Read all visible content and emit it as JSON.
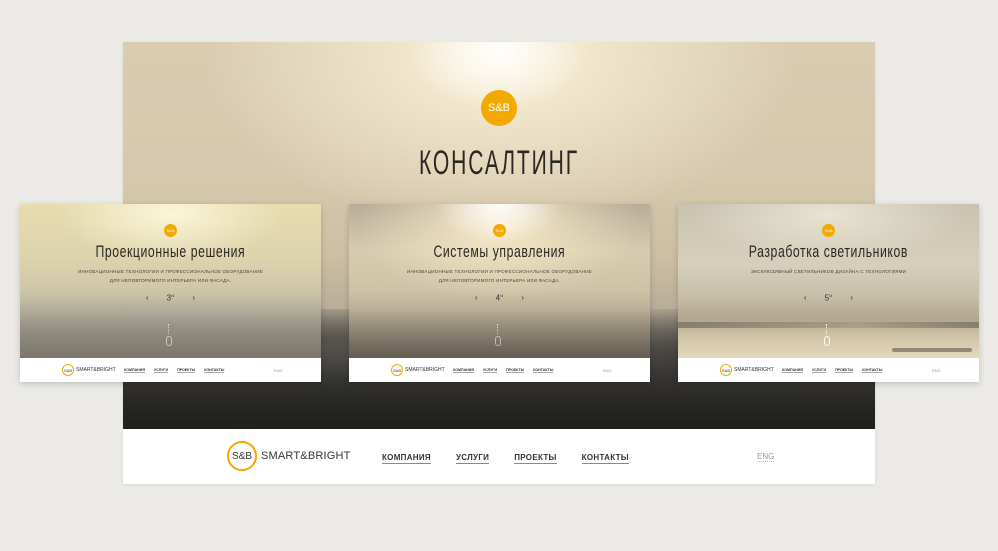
{
  "main": {
    "logo_text": "S&B",
    "title": "КОНСАЛТИНГ",
    "footer": {
      "brand_circle": "S&B",
      "brand_text": "SMART&BRIGHT",
      "nav": [
        "КОМПАНИЯ",
        "УСЛУГИ",
        "ПРОЕКТЫ",
        "КОНТАКТЫ"
      ],
      "lang": "ENG"
    }
  },
  "cards": [
    {
      "logo_text": "S&B",
      "title": "Проекционные решения",
      "subtitle_line1": "ИННОВАЦИОННЫЕ ТЕХНОЛОГИИ И ПРОФЕССИОНАЛЬНОЕ ОБОРУДОВАНИЕ",
      "subtitle_line2": "ДЛЯ НЕПОВТОРИМОГО ИНТЕРЬЕРА ИЛИ ФАСАДА.",
      "page_number": "3",
      "page_suffix": "/4",
      "prev": "‹",
      "next": "›",
      "footer": {
        "brand_circle": "S&B",
        "brand_text": "SMART&BRIGHT",
        "nav": [
          "КОМПАНИЯ",
          "УСЛУГИ",
          "ПРОЕКТЫ",
          "КОНТАКТЫ"
        ],
        "lang": "ENG"
      }
    },
    {
      "logo_text": "S&B",
      "title": "Системы управления",
      "subtitle_line1": "ИННОВАЦИОННЫЕ ТЕХНОЛОГИИ И ПРОФЕССИОНАЛЬНОЕ ОБОРУДОВАНИЕ",
      "subtitle_line2": "ДЛЯ НЕПОВТОРИМОГО ИНТЕРЬЕРА ИЛИ ФАСАДА.",
      "page_number": "4",
      "page_suffix": "/4",
      "prev": "‹",
      "next": "›",
      "footer": {
        "brand_circle": "S&B",
        "brand_text": "SMART&BRIGHT",
        "nav": [
          "КОМПАНИЯ",
          "УСЛУГИ",
          "ПРОЕКТЫ",
          "КОНТАКТЫ"
        ],
        "lang": "ENG"
      }
    },
    {
      "logo_text": "S&B",
      "title": "Разработка светильников",
      "subtitle_line1": "ЭКСКЛЮЗИВНЫЙ СВЕТИЛЬНИКОВ ДИЗАЙНА С ТЕХНОЛОГИЯМИ",
      "subtitle_line2": "",
      "page_number": "5",
      "page_suffix": "/4",
      "prev": "‹",
      "next": "›",
      "footer": {
        "brand_circle": "S&B",
        "brand_text": "SMART&BRIGHT",
        "nav": [
          "КОМПАНИЯ",
          "УСЛУГИ",
          "ПРОЕКТЫ",
          "КОНТАКТЫ"
        ],
        "lang": "ENG"
      }
    }
  ],
  "colors": {
    "accent": "#f2a900",
    "page_background": "#ebeae6",
    "text_dark": "#2b2824"
  }
}
